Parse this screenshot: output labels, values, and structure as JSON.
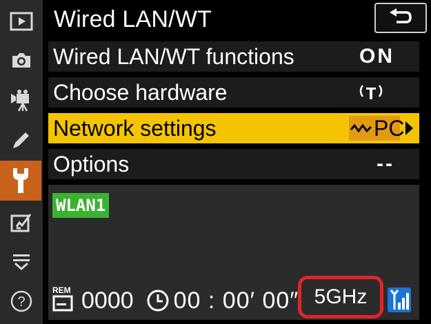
{
  "header": {
    "title": "Wired LAN/WT"
  },
  "menu": {
    "items": [
      {
        "label": "Wired LAN/WT functions",
        "value": "ON"
      },
      {
        "label": "Choose hardware",
        "value": ""
      },
      {
        "label": "Network settings",
        "value": "PC"
      },
      {
        "label": "Options",
        "value": "--"
      }
    ]
  },
  "panel": {
    "profile": "WLAN1",
    "rem_label": "REM",
    "remaining_shots": "0000",
    "elapsed_time": "00 : 00′ 00″",
    "frequency": "5GHz"
  },
  "rail": {
    "icons": [
      "playback-icon",
      "camera-icon",
      "movie-icon",
      "pencil-icon",
      "wrench-icon",
      "retouch-icon",
      "my-menu-icon",
      "help-icon"
    ],
    "active": "wrench-icon"
  },
  "colors": {
    "selected_row": "#f5c400",
    "active_tab": "#c8621c",
    "profile_badge": "#3cb233",
    "highlight_ring": "#e0242b",
    "signal": "#1c74d4"
  }
}
